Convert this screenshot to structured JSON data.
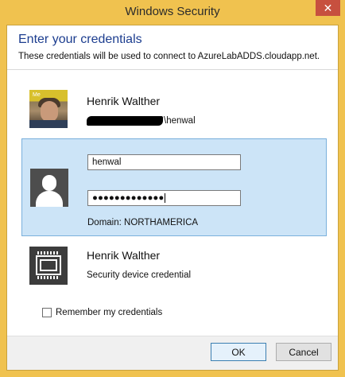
{
  "window": {
    "title": "Windows Security",
    "close_glyph": "✕"
  },
  "header": {
    "heading": "Enter your credentials",
    "subheading": "These credentials will be used to connect to AzureLabADDS.cloudapp.net."
  },
  "credentials": [
    {
      "name": "Henrik Walther",
      "avatar_tag": "Me",
      "account_suffix": "\\henwal",
      "account_redacted": true,
      "icon": "user-photo"
    },
    {
      "selected": true,
      "icon": "generic-user-icon",
      "username_value": "henwal",
      "password_mask": "●●●●●●●●●●●●●",
      "domain_text": "Domain: NORTHAMERICA"
    },
    {
      "name": "Henrik Walther",
      "sub": "Security device credential",
      "icon": "smart-card-icon"
    }
  ],
  "remember": {
    "label": "Remember my credentials",
    "checked": false
  },
  "buttons": {
    "ok": "OK",
    "cancel": "Cancel"
  },
  "colors": {
    "frame": "#f0c24f",
    "heading": "#1c3d8f",
    "selected_bg": "#cce4f7",
    "selected_border": "#7ab0dc",
    "close_button": "#c7503f"
  }
}
